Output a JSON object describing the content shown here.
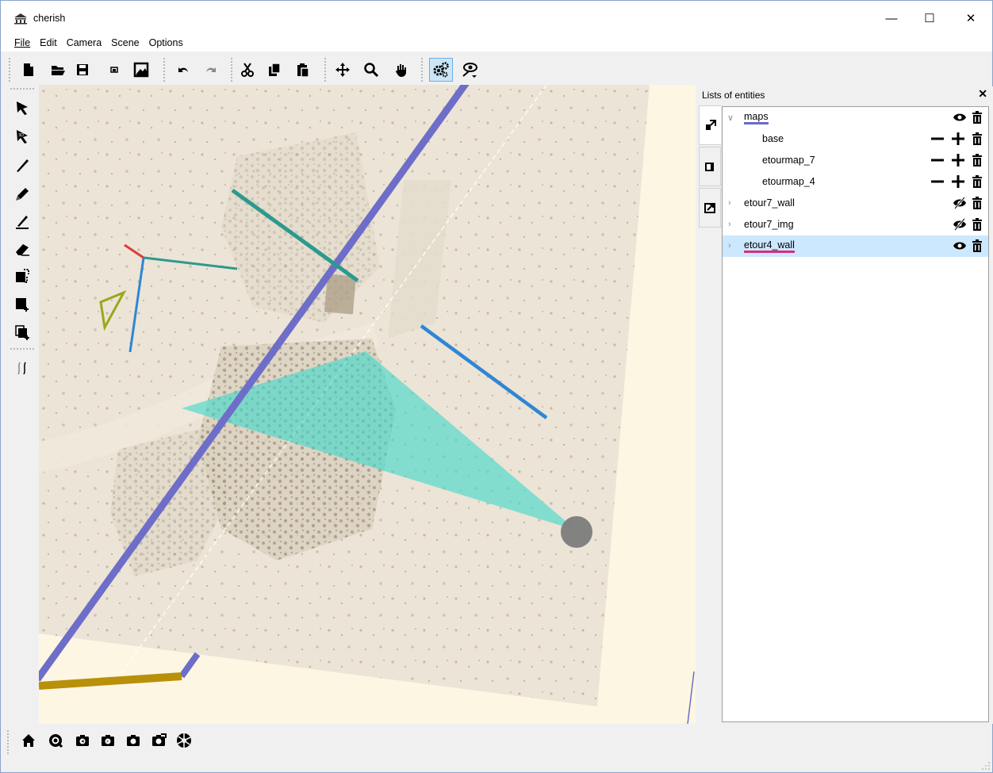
{
  "window": {
    "title": "cherish",
    "minimize_glyph": "—",
    "maximize_glyph": "☐",
    "close_glyph": "✕"
  },
  "menu": [
    {
      "label": "File",
      "mnemonic": "F"
    },
    {
      "label": "Edit",
      "mnemonic": "E"
    },
    {
      "label": "Camera",
      "mnemonic": ""
    },
    {
      "label": "Scene",
      "mnemonic": "S"
    },
    {
      "label": "Options",
      "mnemonic": "O"
    }
  ],
  "toolbar": {
    "buttons": [
      "new-file-icon",
      "open-folder-icon",
      "save-icon",
      "small-image-icon",
      "export-image-icon",
      "undo-icon",
      "redo-icon",
      "cut-icon",
      "copy-icon",
      "paste-icon",
      "move-icon",
      "zoom-icon",
      "pan-hand-icon",
      "settings-gears-icon",
      "visibility-eye-icon"
    ],
    "active": "settings-gears-icon"
  },
  "left_tools": [
    "select-arrow-icon",
    "select-3d-icon",
    "pen-icon",
    "pencil-fill-icon",
    "stroke-edit-icon",
    "eraser-icon",
    "canvas-move-icon",
    "canvas-add-icon",
    "canvas-clone-icon",
    "strokes-icon"
  ],
  "dock": {
    "title": "Lists of entities",
    "close_glyph": "✕",
    "tree": [
      {
        "label": "maps",
        "expanded": true,
        "level": 0,
        "underline_color": "#6a6acf",
        "icons": [
          "eye-icon",
          "trash-icon"
        ]
      },
      {
        "label": "base",
        "level": 1,
        "icons": [
          "minus-icon",
          "plus-icon",
          "trash-icon"
        ]
      },
      {
        "label": "etourmap_7",
        "level": 1,
        "icons": [
          "minus-icon",
          "plus-icon",
          "trash-icon"
        ]
      },
      {
        "label": "etourmap_4",
        "level": 1,
        "icons": [
          "minus-icon",
          "plus-icon",
          "trash-icon"
        ]
      },
      {
        "label": "etour7_wall",
        "expanded": false,
        "level": 0,
        "icons": [
          "eye-hidden-icon",
          "trash-icon"
        ]
      },
      {
        "label": "etour7_img",
        "expanded": false,
        "level": 0,
        "icons": [
          "eye-hidden-icon",
          "trash-icon"
        ]
      },
      {
        "label": "etour4_wall",
        "expanded": false,
        "level": 0,
        "selected": true,
        "underline_color": "#d6307a",
        "icons": [
          "eye-icon",
          "trash-icon"
        ]
      }
    ],
    "selected_row_color": "#cce8ff"
  },
  "bottom_tools": [
    "home-icon",
    "camera-focus-icon",
    "camera-prev-icon",
    "camera-next-icon",
    "camera-add-icon",
    "camera-edit-icon",
    "camera-aperture-icon"
  ],
  "colors": {
    "canvas_bg": "#fdf6e3",
    "photo_paper": "#ece4d6",
    "wall_stroke": "#6e6ec8",
    "floor_stroke": "#b8900a",
    "frustum": "#40d8cc",
    "teal_stroke": "#2b9a8e",
    "blue_stroke": "#2f86d4",
    "red_stroke": "#e03b3b",
    "olive_stroke": "#98a81a",
    "camera_dot": "#7c7c7c"
  }
}
